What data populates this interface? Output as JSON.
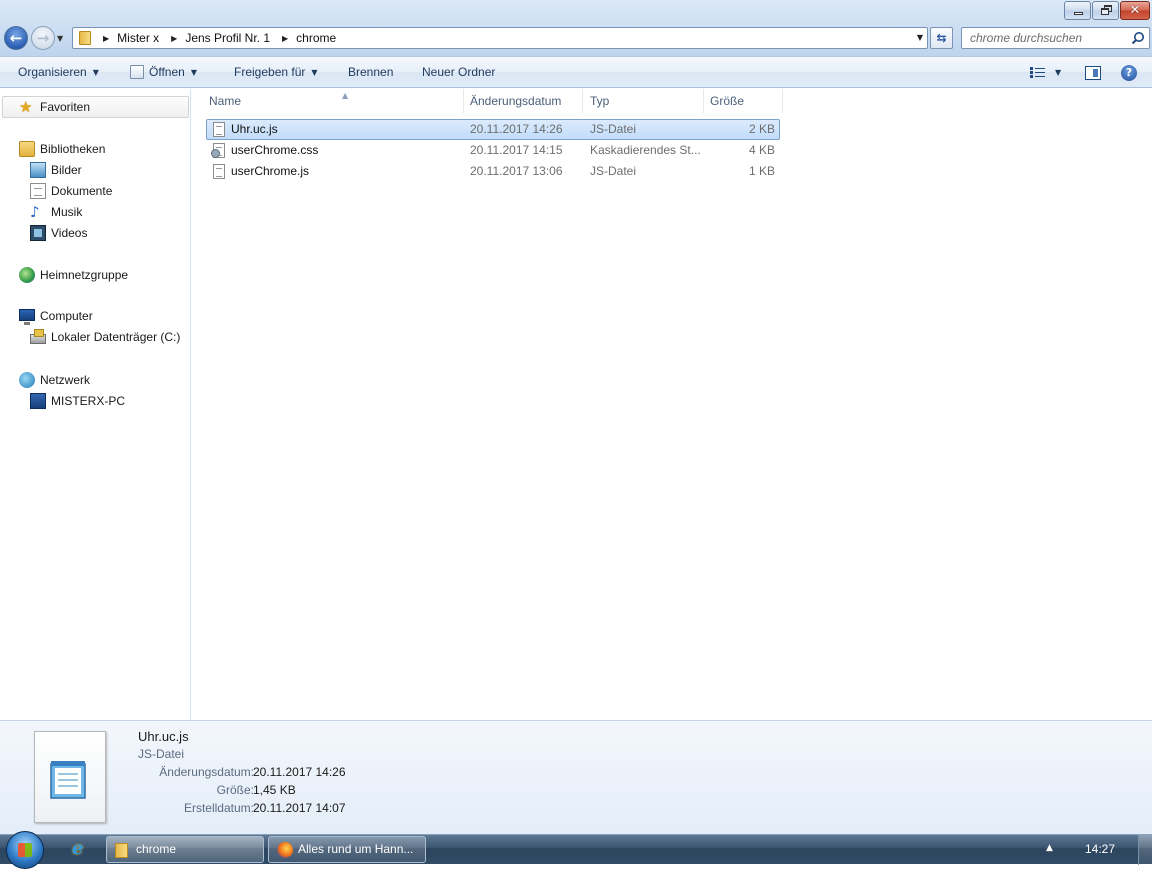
{
  "window": {
    "close_glyph": "✕"
  },
  "navigation": {
    "back_icon": "arrow-left-icon",
    "forward_icon": "arrow-right-icon"
  },
  "address_bar": {
    "breadcrumbs": [
      "Mister x",
      "Jens Profil Nr. 1",
      "chrome"
    ]
  },
  "search": {
    "placeholder": "chrome durchsuchen"
  },
  "toolbar": {
    "organize": "Organisieren",
    "open": "Öffnen",
    "share": "Freigeben für",
    "burn": "Brennen",
    "new_folder": "Neuer Ordner",
    "help": "?"
  },
  "sidebar": {
    "favorites": "Favoriten",
    "libraries": "Bibliotheken",
    "pictures": "Bilder",
    "documents": "Dokumente",
    "music": "Musik",
    "videos": "Videos",
    "homegroup": "Heimnetzgruppe",
    "computer": "Computer",
    "local_disk": "Lokaler Datenträger (C:)",
    "network": "Netzwerk",
    "pc": "MISTERX-PC"
  },
  "columns": {
    "name": "Name",
    "date": "Änderungsdatum",
    "type": "Typ",
    "size": "Größe"
  },
  "files": [
    {
      "name": "Uhr.uc.js",
      "date": "20.11.2017 14:26",
      "type": "JS-Datei",
      "size": "2 KB",
      "selected": true
    },
    {
      "name": "userChrome.css",
      "date": "20.11.2017 14:15",
      "type": "Kaskadierendes St...",
      "size": "4 KB",
      "selected": false
    },
    {
      "name": "userChrome.js",
      "date": "20.11.2017 13:06",
      "type": "JS-Datei",
      "size": "1 KB",
      "selected": false
    }
  ],
  "details": {
    "name": "Uhr.uc.js",
    "type": "JS-Datei",
    "modified_label": "Änderungsdatum:",
    "modified_value": "20.11.2017 14:26",
    "size_label": "Größe:",
    "size_value": "1,45 KB",
    "created_label": "Erstelldatum:",
    "created_value": "20.11.2017 14:07"
  },
  "taskbar": {
    "explorer_task": "chrome",
    "firefox_task": "Alles rund um Hann...",
    "clock": "14:27"
  },
  "colors": {
    "selection": "#cce8ff",
    "link_text": "#1e395b"
  }
}
